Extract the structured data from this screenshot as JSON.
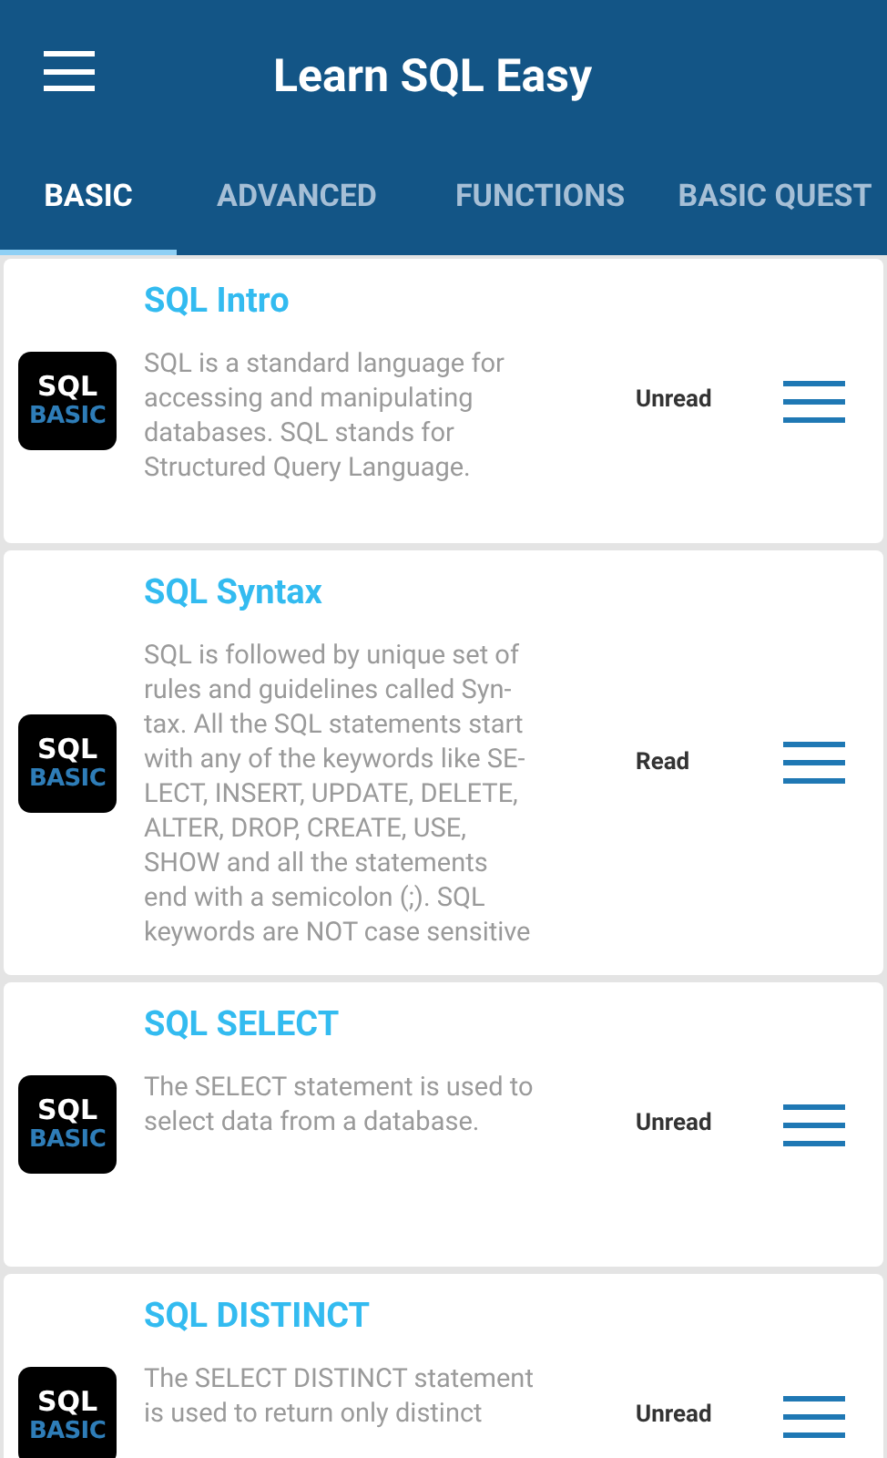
{
  "app_bar": {
    "title": "Learn SQL Easy"
  },
  "tabs": [
    {
      "label": "BASIC",
      "selected": true
    },
    {
      "label": "ADVANCED",
      "selected": false
    },
    {
      "label": "FUNCTIONS",
      "selected": false
    },
    {
      "label": "BASIC QUEST",
      "selected": false
    }
  ],
  "lessons": [
    {
      "title": "SQL Intro",
      "icon_top": "SQL",
      "icon_bottom": "BASIC",
      "description_lines": [
        "SQL is a standard language for",
        "accessing and manipulating",
        "databases. SQL stands for",
        "Structured Query Language."
      ],
      "status": "Unread"
    },
    {
      "title": "SQL Syntax",
      "icon_top": "SQL",
      "icon_bottom": "BASIC",
      "description_lines": [
        "SQL is followed by unique set of",
        "rules and guidelines called Syn-",
        "tax. All the SQL statements start",
        "with any of the keywords like SE-",
        "LECT, INSERT, UPDATE, DELETE,",
        "ALTER, DROP, CREATE, USE,",
        "SHOW and all the statements",
        "end with a semicolon (;). SQL",
        "keywords are NOT case sensitive"
      ],
      "status": "Read"
    },
    {
      "title": "SQL SELECT",
      "icon_top": "SQL",
      "icon_bottom": "BASIC",
      "description_lines": [
        "The SELECT statement is used to",
        "select data from a database."
      ],
      "status": "Unread"
    },
    {
      "title": "SQL DISTINCT",
      "icon_top": "SQL",
      "icon_bottom": "BASIC",
      "description_lines": [
        "The SELECT DISTINCT statement",
        "is used to return only distinct"
      ],
      "status": "Unread"
    }
  ]
}
